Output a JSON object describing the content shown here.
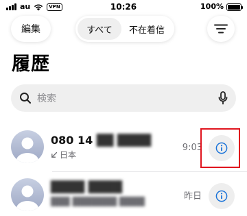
{
  "status_bar": {
    "carrier": "au",
    "vpn": "VPN",
    "time": "10:26",
    "battery_percent": "100%",
    "battery_level": 1.0
  },
  "toolbar": {
    "edit_label": "編集",
    "filter_all_label": "すべて",
    "filter_missed_label": "不在着信",
    "selected_filter": "すべて",
    "menu_icon": "list-filter-icon"
  },
  "page": {
    "title": "履歴"
  },
  "search": {
    "placeholder": "検索",
    "icon": "search-icon",
    "mic_icon": "microphone-icon"
  },
  "calls": [
    {
      "name": "080 14",
      "name_obscured": "██ ████",
      "subtitle": "日本",
      "call_type_icon": "outgoing-call-arrow-icon",
      "time": "9:03",
      "info_icon": "info-icon"
    },
    {
      "name_obscured": "████ ████",
      "subtitle_obscured": "███ ███████ ████",
      "time": "昨日",
      "info_icon": "info-icon"
    }
  ],
  "colors": {
    "accent": "#1a73d9",
    "highlight_box": "#e0141e",
    "secondary_text": "#6d6d72",
    "avatar_bg": "#b9c3da"
  }
}
